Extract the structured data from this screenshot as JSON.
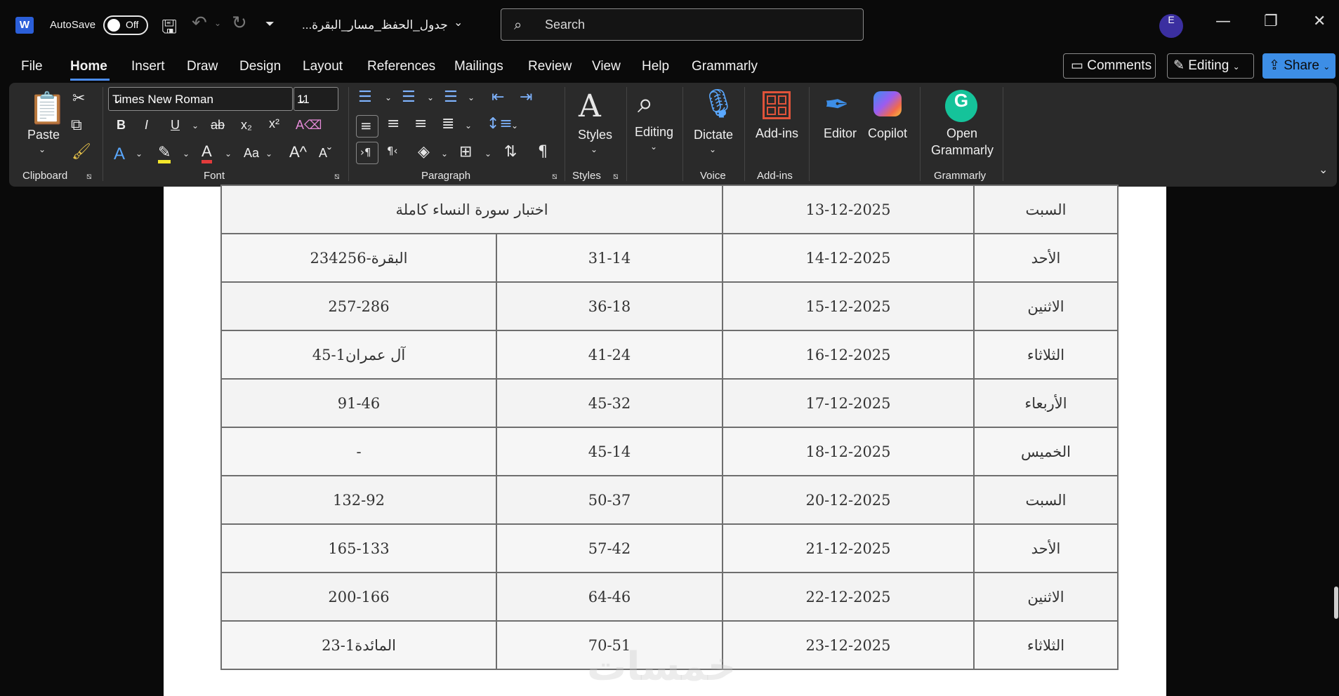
{
  "titlebar": {
    "autosave_label": "AutoSave",
    "autosave_state": "Off",
    "document_title": "...جدول_الحفظ_مسار_البقرة",
    "search_placeholder": "Search",
    "avatar_initial": "E"
  },
  "menu": {
    "tabs": [
      "File",
      "Home",
      "Insert",
      "Draw",
      "Design",
      "Layout",
      "References",
      "Mailings",
      "Review",
      "View",
      "Help",
      "Grammarly"
    ],
    "active_tab": "Home",
    "comments_label": "Comments",
    "editing_label": "Editing",
    "share_label": "Share"
  },
  "ribbon": {
    "clipboard": {
      "paste_label": "Paste",
      "group_label": "Clipboard"
    },
    "font": {
      "font_name": "Times New Roman",
      "font_size": "11",
      "group_label": "Font"
    },
    "paragraph": {
      "group_label": "Paragraph"
    },
    "styles": {
      "styles_label": "Styles",
      "group_label": "Styles"
    },
    "editing": {
      "label": "Editing"
    },
    "voice": {
      "dictate_label": "Dictate",
      "group_label": "Voice"
    },
    "addins": {
      "label": "Add-ins",
      "group_label": "Add-ins"
    },
    "editor_label": "Editor",
    "copilot_label": "Copilot",
    "grammarly": {
      "open_label": "Open",
      "name_label": "Grammarly",
      "group_label": "Grammarly"
    }
  },
  "table": {
    "rows": [
      {
        "day": "السبت",
        "date": "13-12-2025",
        "merged": "اختبار سورة النساء كاملة",
        "date_bold": true
      },
      {
        "day": "الأحد",
        "date": "14-12-2025",
        "review": "31-14",
        "new": "البقرة-234256"
      },
      {
        "day": "الاثنين",
        "date": "15-12-2025",
        "review": "36-18",
        "new": "257-286"
      },
      {
        "day": "الثلاثاء",
        "date": "16-12-2025",
        "review": "41-24",
        "new": "آل عمران1-45"
      },
      {
        "day": "الأربعاء",
        "date": "17-12-2025",
        "review": "45-32",
        "new": "91-46"
      },
      {
        "day": "الخميس",
        "date": "18-12-2025",
        "review": "45-14",
        "new": "-"
      },
      {
        "day": "السبت",
        "date": "20-12-2025",
        "review": "50-37",
        "new": "132-92"
      },
      {
        "day": "الأحد",
        "date": "21-12-2025",
        "review": "57-42",
        "new": "165-133"
      },
      {
        "day": "الاثنين",
        "date": "22-12-2025",
        "review": "64-46",
        "new": "200-166"
      },
      {
        "day": "الثلاثاء",
        "date": "23-12-2025",
        "review": "70-51",
        "new": "المائدة1-23"
      }
    ]
  },
  "watermark": "خمسات",
  "colors": {
    "accent": "#4b8df0",
    "share_bg": "#3d8ee6",
    "ribbon_bg": "#2a2a2a",
    "avatar_bg": "#3b2fa0"
  }
}
